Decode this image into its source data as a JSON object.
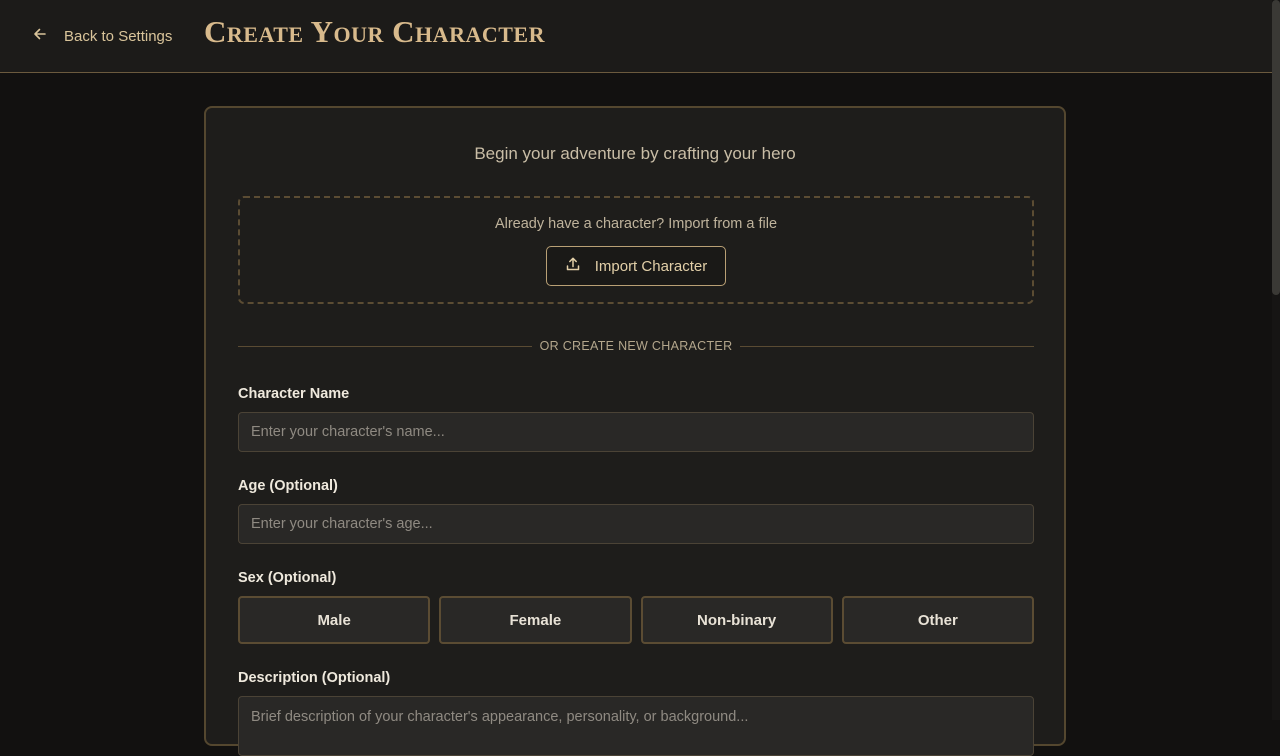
{
  "header": {
    "back_label": "Back to Settings",
    "title": "Create Your Character"
  },
  "card": {
    "subtitle": "Begin your adventure by crafting your hero",
    "import": {
      "prompt": "Already have a character? Import from a file",
      "button_label": "Import Character"
    },
    "divider_label": "OR CREATE NEW CHARACTER",
    "fields": {
      "name": {
        "label": "Character Name",
        "placeholder": "Enter your character's name..."
      },
      "age": {
        "label": "Age (Optional)",
        "placeholder": "Enter your character's age..."
      },
      "sex": {
        "label": "Sex (Optional)",
        "options": [
          "Male",
          "Female",
          "Non-binary",
          "Other"
        ]
      },
      "description": {
        "label": "Description (Optional)",
        "placeholder": "Brief description of your character's appearance, personality, or background..."
      }
    }
  },
  "colors": {
    "accent": "#d8ba8c",
    "border": "#54472f",
    "background": "#121110",
    "card": "#1e1d1b"
  },
  "icons": {
    "back": "arrow-left-icon",
    "import": "upload-icon"
  }
}
